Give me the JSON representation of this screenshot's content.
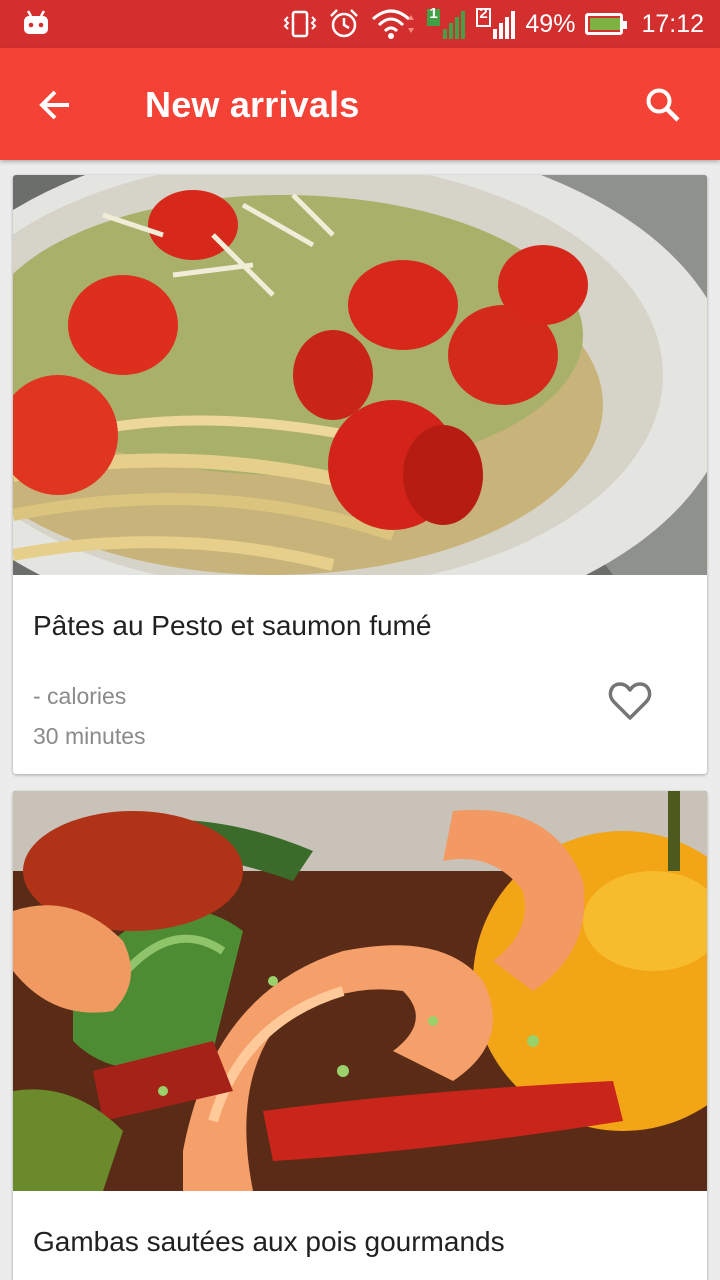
{
  "status_bar": {
    "battery_percent": "49%",
    "time": "17:12",
    "sim1": "1",
    "sim2": "2"
  },
  "app_bar": {
    "title": "New arrivals",
    "back_icon": "arrow-left-icon",
    "search_icon": "search-icon"
  },
  "recipes": [
    {
      "name": "Pâtes au Pesto et saumon fumé",
      "calories": "- calories",
      "duration": "30 minutes",
      "favorite": false
    },
    {
      "name": "Gambas sautées aux pois gourmands",
      "calories": "",
      "duration": "",
      "favorite": false
    }
  ],
  "colors": {
    "status_bar": "#d32f2f",
    "app_bar": "#f44336",
    "background": "#ececec"
  }
}
